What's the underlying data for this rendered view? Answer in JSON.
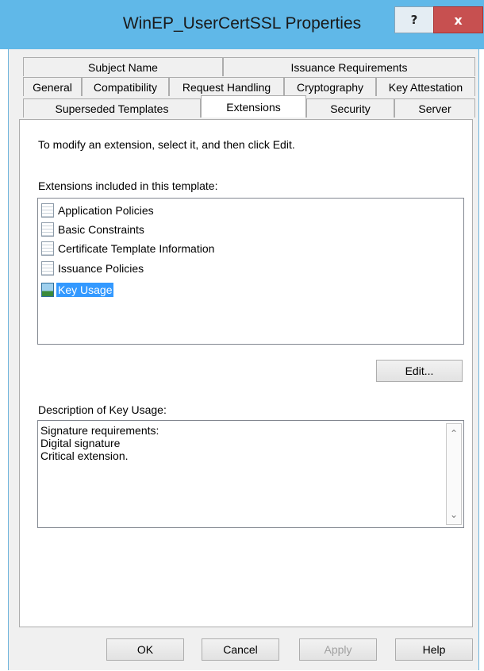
{
  "window": {
    "title": "WinEP_UserCertSSL Properties",
    "help_label": "?",
    "close_label": "x"
  },
  "tabs": {
    "row1": [
      {
        "label": "Subject Name"
      },
      {
        "label": "Issuance Requirements"
      }
    ],
    "row2": [
      {
        "label": "General"
      },
      {
        "label": "Compatibility"
      },
      {
        "label": "Request Handling"
      },
      {
        "label": "Cryptography"
      },
      {
        "label": "Key Attestation"
      }
    ],
    "row3": [
      {
        "label": "Superseded Templates"
      },
      {
        "label": "Extensions",
        "active": true
      },
      {
        "label": "Security"
      },
      {
        "label": "Server"
      }
    ]
  },
  "extensions_page": {
    "instruction": "To modify an extension, select it, and then click Edit.",
    "list_label": "Extensions included in this template:",
    "items": [
      {
        "label": "Application Policies",
        "icon": "certificate-extension-icon"
      },
      {
        "label": "Basic Constraints",
        "icon": "certificate-extension-icon"
      },
      {
        "label": "Certificate Template Information",
        "icon": "certificate-extension-icon"
      },
      {
        "label": "Issuance Policies",
        "icon": "certificate-extension-icon"
      },
      {
        "label": "Key Usage",
        "icon": "critical-extension-icon",
        "selected": true
      }
    ],
    "edit_label": "Edit...",
    "description_label": "Description of Key Usage:",
    "description_lines": [
      "Signature requirements:",
      "Digital signature",
      "Critical extension."
    ]
  },
  "footer": {
    "ok_label": "OK",
    "cancel_label": "Cancel",
    "apply_label": "Apply",
    "help_label": "Help"
  },
  "colors": {
    "titlebar": "#60b8e8",
    "selection": "#3399ff",
    "close_button": "#c75050"
  }
}
